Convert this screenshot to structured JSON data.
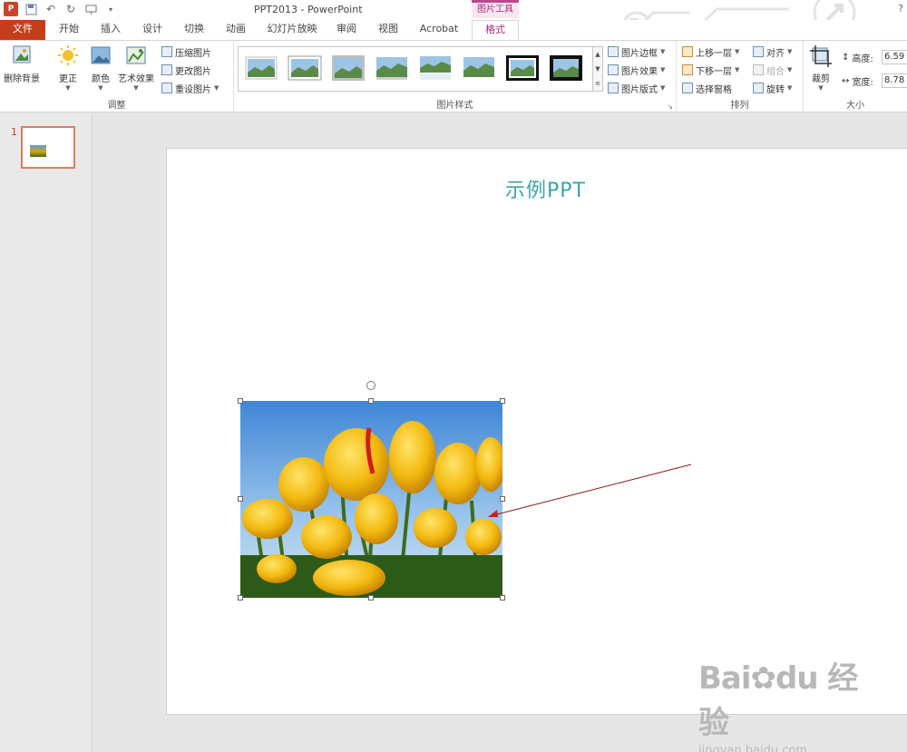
{
  "window": {
    "title": "PPT2013 - PowerPoint",
    "context_tab_group": "图片工具",
    "help": "?"
  },
  "tabs": [
    {
      "label": "文件"
    },
    {
      "label": "开始"
    },
    {
      "label": "插入"
    },
    {
      "label": "设计"
    },
    {
      "label": "切换"
    },
    {
      "label": "动画"
    },
    {
      "label": "幻灯片放映"
    },
    {
      "label": "审阅"
    },
    {
      "label": "视图"
    },
    {
      "label": "Acrobat"
    },
    {
      "label": "格式"
    }
  ],
  "ribbon": {
    "adjust": {
      "label": "调整",
      "remove_bg": "删除背景",
      "corrections": "更正",
      "color": "颜色",
      "artistic": "艺术效果",
      "compress": "压缩图片",
      "change": "更改图片",
      "reset": "重设图片"
    },
    "styles": {
      "label": "图片样式",
      "border": "图片边框",
      "effects": "图片效果",
      "layout": "图片版式"
    },
    "arrange": {
      "label": "排列",
      "bring_forward": "上移一层",
      "send_backward": "下移一层",
      "selection_pane": "选择窗格",
      "align": "对齐",
      "group": "组合",
      "rotate": "旋转"
    },
    "size": {
      "label": "大小",
      "crop": "裁剪",
      "height_label": "高度:",
      "height_value": "6.59",
      "width_label": "宽度:",
      "width_value": "8.78"
    }
  },
  "slides_pane": {
    "slide_number": "1"
  },
  "slide": {
    "title": "示例PPT"
  },
  "watermark": {
    "brand": "Bai",
    "brand2": "du",
    "cn": "经验",
    "url": "jingyan.baidu.com"
  },
  "colors": {
    "file_tab": "#c43e1c",
    "format_tab": "#a7287a",
    "title_text": "#3aa3a8",
    "arrow": "#8b1a1a"
  }
}
